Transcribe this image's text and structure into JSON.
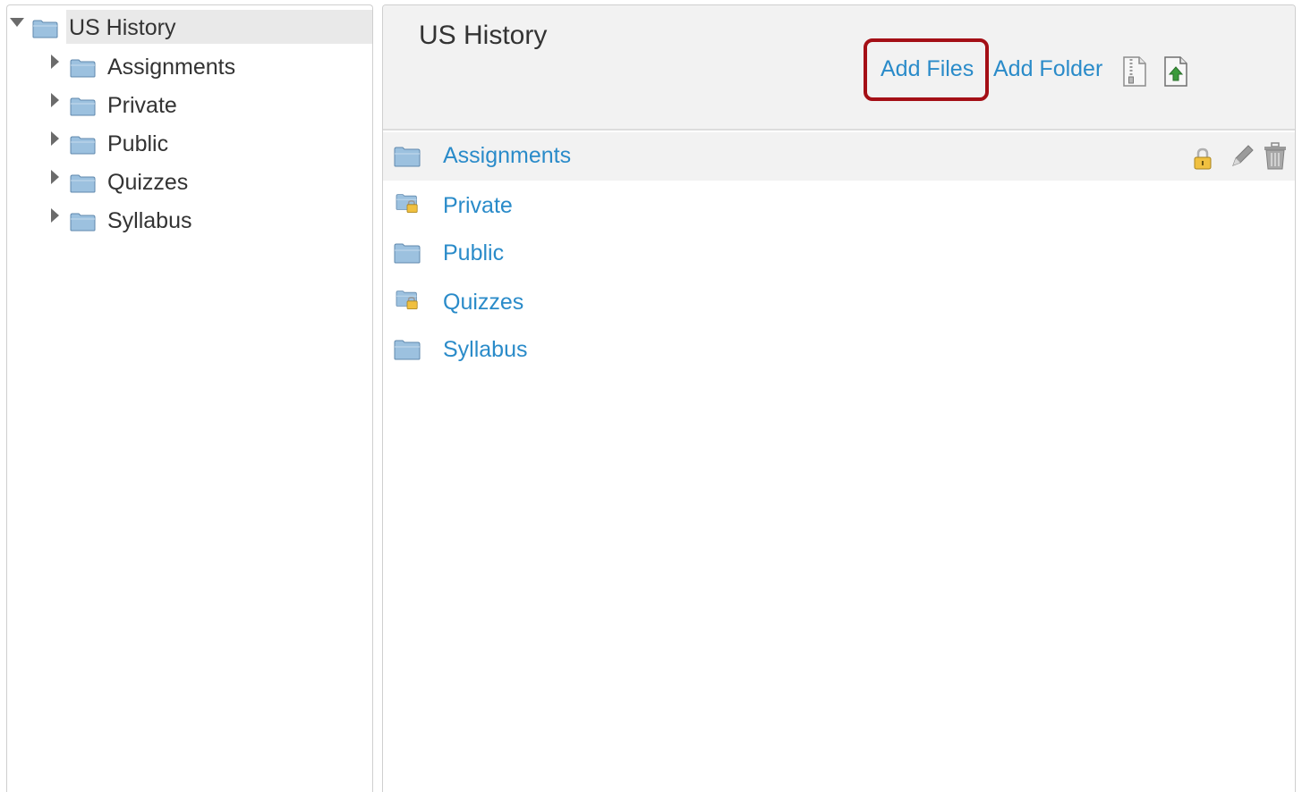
{
  "tree": {
    "root": {
      "label": "US History",
      "expanded": true
    },
    "children": [
      {
        "label": "Assignments",
        "expanded": false
      },
      {
        "label": "Private",
        "expanded": false
      },
      {
        "label": "Public",
        "expanded": false
      },
      {
        "label": "Quizzes",
        "expanded": false
      },
      {
        "label": "Syllabus",
        "expanded": false
      }
    ]
  },
  "content": {
    "title": "US History",
    "toolbar": {
      "add_files_label": "Add Files",
      "add_folder_label": "Add Folder",
      "zip_icon": "zip-file-icon",
      "upload_icon": "upload-zip-icon",
      "highlight_color": "#a40f16"
    },
    "items": [
      {
        "label": "Assignments",
        "locked": false,
        "icon": "folder-icon"
      },
      {
        "label": "Private",
        "locked": true,
        "icon": "locked-folder-icon"
      },
      {
        "label": "Public",
        "locked": false,
        "icon": "folder-icon"
      },
      {
        "label": "Quizzes",
        "locked": true,
        "icon": "locked-folder-icon"
      },
      {
        "label": "Syllabus",
        "locked": false,
        "icon": "folder-icon"
      }
    ],
    "row_actions": [
      "lock-icon",
      "edit-pencil-icon",
      "trash-icon"
    ]
  },
  "colors": {
    "link": "#2a8bc9",
    "folder": "#9cc1df",
    "header_bg": "#f2f2f2"
  }
}
